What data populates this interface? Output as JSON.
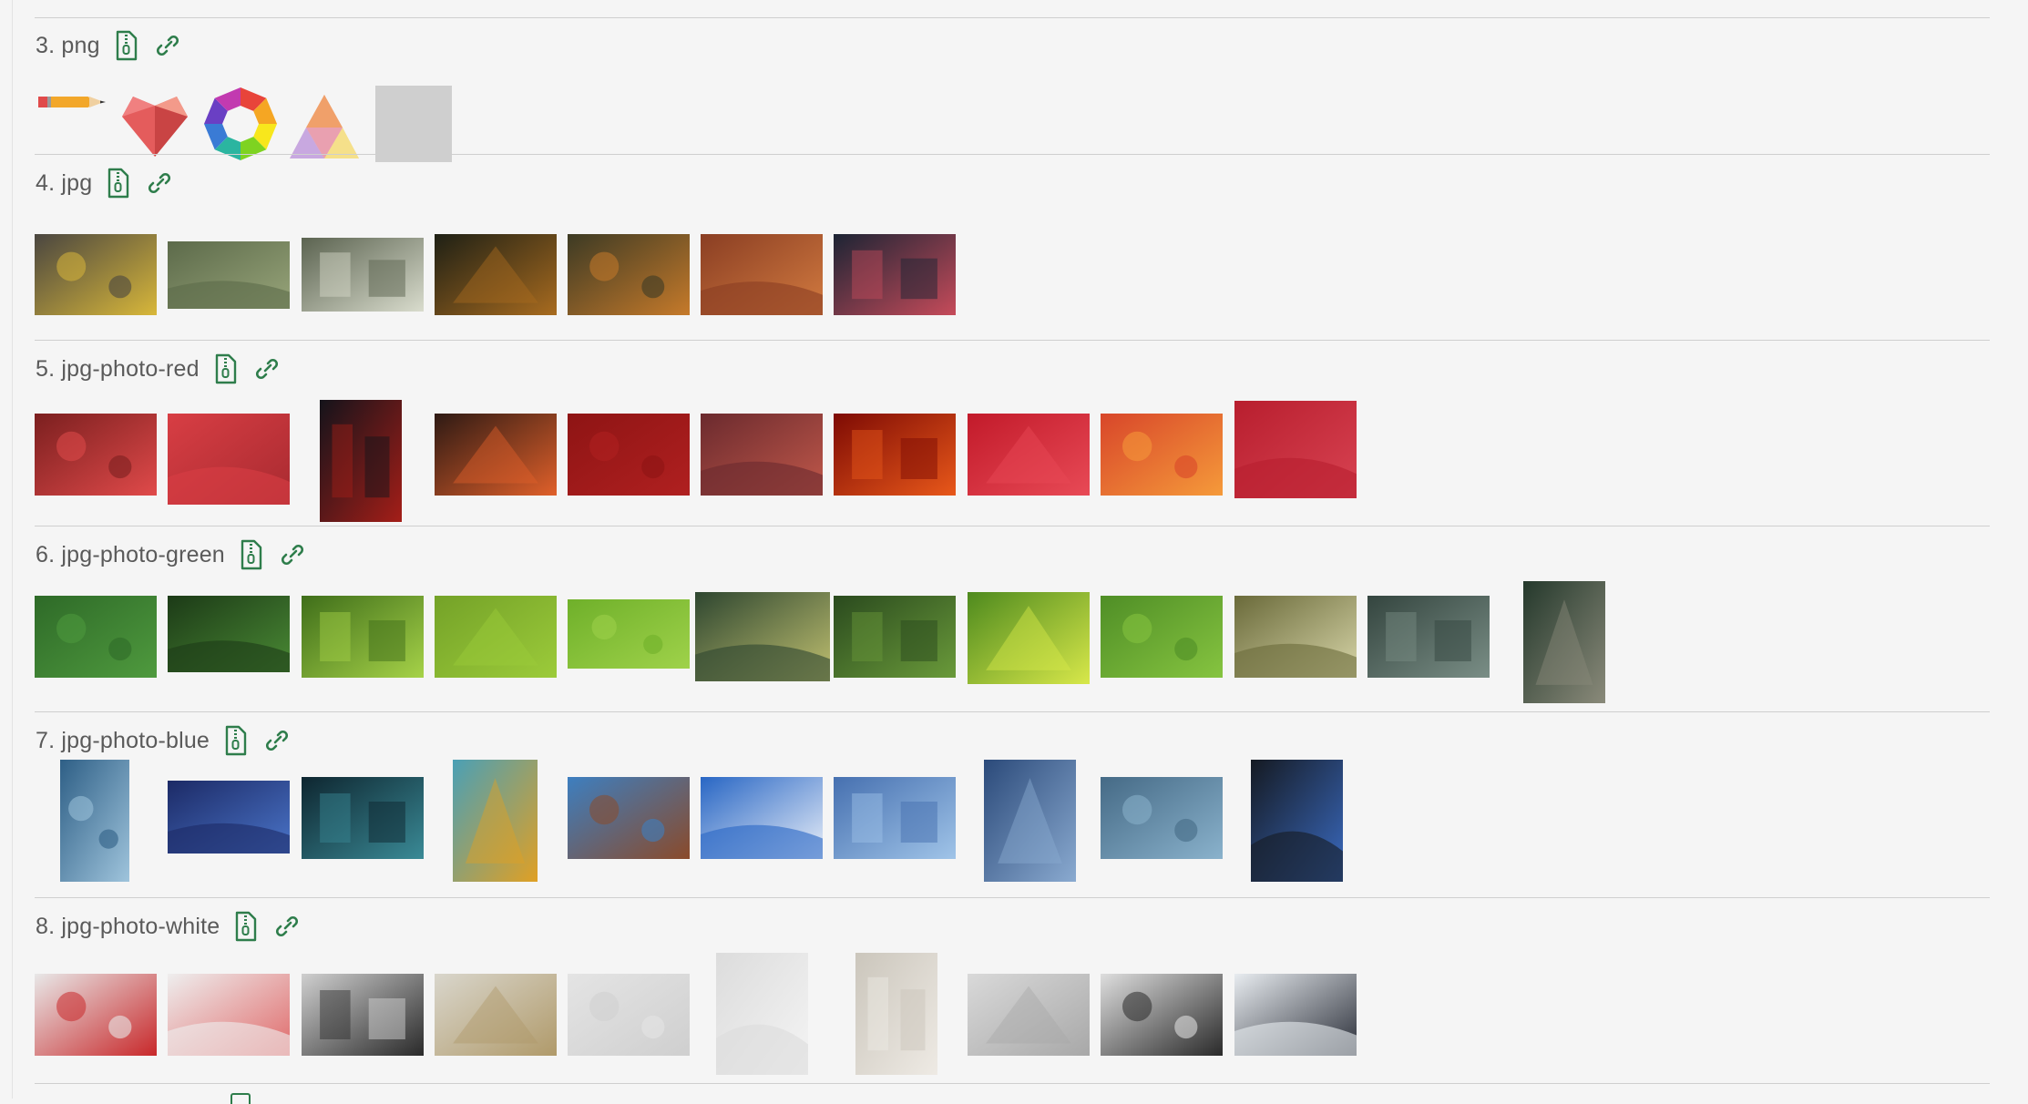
{
  "sections": [
    {
      "id": "png",
      "title": "3. png",
      "thumbs": [
        {
          "name": "pencil-image",
          "fill": "#f2a72a"
        },
        {
          "name": "heart-image",
          "fill": "#e45c5c"
        },
        {
          "name": "ring-image",
          "fill": "#3a7bd5"
        },
        {
          "name": "triangle-image",
          "fill": "#e9a0b0"
        },
        {
          "name": "gray-square-image",
          "fill": "#cfcfcf"
        }
      ]
    },
    {
      "id": "jpg",
      "title": "4. jpg",
      "thumbs": [
        {
          "name": "city-street-photo",
          "fill": "#4a4640",
          "accent": "#d8b73a"
        },
        {
          "name": "misty-forest-photo",
          "fill": "#5c6a4a",
          "accent": "#98a57a"
        },
        {
          "name": "storefront-photo",
          "fill": "#5b6350",
          "accent": "#d9dccd"
        },
        {
          "name": "dark-lake-photo",
          "fill": "#1e2015",
          "accent": "#a86b1f"
        },
        {
          "name": "forest-road-photo",
          "fill": "#3c3a24",
          "accent": "#c67a2a"
        },
        {
          "name": "autumn-road-photo",
          "fill": "#8a3e23",
          "accent": "#d37b40"
        },
        {
          "name": "neon-alley-photo",
          "fill": "#1c2434",
          "accent": "#c64b5a"
        }
      ]
    },
    {
      "id": "jpg-photo-red",
      "title": "5. jpg-photo-red",
      "thumbs": [
        {
          "name": "red-blossom-photo",
          "fill": "#7b1f1f",
          "accent": "#e04a4a"
        },
        {
          "name": "red-wood-photo",
          "fill": "#d83e44",
          "accent": "#a82a30"
        },
        {
          "name": "torii-path-photo",
          "fill": "#14131a",
          "accent": "#a41e18"
        },
        {
          "name": "red-leaves-branch-photo",
          "fill": "#2e1a14",
          "accent": "#e0602a"
        },
        {
          "name": "red-panels-photo",
          "fill": "#8e1414",
          "accent": "#b02020"
        },
        {
          "name": "red-foliage-photo",
          "fill": "#6b2a2e",
          "accent": "#c0584a"
        },
        {
          "name": "red-gradient-photo",
          "fill": "#7e0b04",
          "accent": "#e8581a"
        },
        {
          "name": "raspberries-photo",
          "fill": "#c21a2a",
          "accent": "#e84a56"
        },
        {
          "name": "orange-leaves-photo",
          "fill": "#d8462a",
          "accent": "#f59a3a"
        },
        {
          "name": "red-polygon-photo",
          "fill": "#b81e2e",
          "accent": "#d84352"
        }
      ]
    },
    {
      "id": "jpg-photo-green",
      "title": "6. jpg-photo-green",
      "thumbs": [
        {
          "name": "clover-photo",
          "fill": "#2e6a28",
          "accent": "#4f9a3e"
        },
        {
          "name": "succulent-photo",
          "fill": "#1c3a17",
          "accent": "#4a8a34"
        },
        {
          "name": "green-leaves-photo",
          "fill": "#3f6e1a",
          "accent": "#a6d248"
        },
        {
          "name": "leaf-texture-photo",
          "fill": "#74a228",
          "accent": "#9ccb3a"
        },
        {
          "name": "green-stripe-photo",
          "fill": "#6fb02a",
          "accent": "#9fd24a"
        },
        {
          "name": "dewy-grass-photo",
          "fill": "#2e4630",
          "accent": "#c0c070"
        },
        {
          "name": "leaf-drop-photo",
          "fill": "#2a4a1e",
          "accent": "#6a9a3a"
        },
        {
          "name": "banana-leaf-photo",
          "fill": "#4e8a1e",
          "accent": "#d8e84a"
        },
        {
          "name": "tall-grass-photo",
          "fill": "#4f8e26",
          "accent": "#86c440"
        },
        {
          "name": "tree-canopy-photo",
          "fill": "#6a6a3a",
          "accent": "#d7d5a8"
        },
        {
          "name": "green-lake-photo",
          "fill": "#34453f",
          "accent": "#7a8e86"
        },
        {
          "name": "hedge-path-photo",
          "fill": "#25392c",
          "accent": "#8a8a7a"
        }
      ]
    },
    {
      "id": "jpg-photo-blue",
      "title": "7. jpg-photo-blue",
      "thumbs": [
        {
          "name": "blue-ice-photo",
          "fill": "#2e5f86",
          "accent": "#9fc4dc"
        },
        {
          "name": "blue-coral-photo",
          "fill": "#1c2a66",
          "accent": "#4a74c8"
        },
        {
          "name": "bokeh-photo",
          "fill": "#0e2630",
          "accent": "#3a8a96"
        },
        {
          "name": "sunflowers-photo",
          "fill": "#4aa0b6",
          "accent": "#e0a024"
        },
        {
          "name": "blue-wall-windows-photo",
          "fill": "#3d7fc0",
          "accent": "#8a4a2a"
        },
        {
          "name": "hot-air-balloon-photo",
          "fill": "#2866c4",
          "accent": "#e8eef8"
        },
        {
          "name": "blue-house-photo",
          "fill": "#4670b0",
          "accent": "#a0c4e8"
        },
        {
          "name": "blue-facade-photo",
          "fill": "#2b4a7a",
          "accent": "#8aaad0"
        },
        {
          "name": "rainy-glass-photo",
          "fill": "#456a86",
          "accent": "#8ab2cc"
        },
        {
          "name": "blue-arch-photo",
          "fill": "#151a22",
          "accent": "#3a6ac0"
        }
      ]
    },
    {
      "id": "jpg-photo-white",
      "title": "8. jpg-photo-white",
      "thumbs": [
        {
          "name": "strawberry-milk-photo",
          "fill": "#e8e8e8",
          "accent": "#c8282a"
        },
        {
          "name": "creative-wall-photo",
          "fill": "#eeeeee",
          "accent": "#e06a6a"
        },
        {
          "name": "foggy-lake-photo",
          "fill": "#cfcfcf",
          "accent": "#2a2a2a"
        },
        {
          "name": "dry-flowers-photo",
          "fill": "#d9d6cc",
          "accent": "#b09a6a"
        },
        {
          "name": "white-texture-photo",
          "fill": "#e4e4e4",
          "accent": "#cfcfcf"
        },
        {
          "name": "vase-paper-photo",
          "fill": "#dcdcdc",
          "accent": "#f4f4f4"
        },
        {
          "name": "white-arch-room-photo",
          "fill": "#cbc6bc",
          "accent": "#eeeae4"
        },
        {
          "name": "spiral-architecture-photo",
          "fill": "#d9d9d9",
          "accent": "#a8a8a8"
        },
        {
          "name": "chair-photo",
          "fill": "#dedede",
          "accent": "#2a2a2a"
        },
        {
          "name": "white-house-roof-photo",
          "fill": "#e8ecf0",
          "accent": "#2a2e38"
        }
      ]
    }
  ],
  "colors": {
    "accent": "#2e7d4b",
    "divider": "#cfcfcf",
    "text": "#5a5a5a",
    "background": "#f5f5f5"
  },
  "icons": {
    "zip": "file-zip-icon",
    "link": "link-icon"
  }
}
